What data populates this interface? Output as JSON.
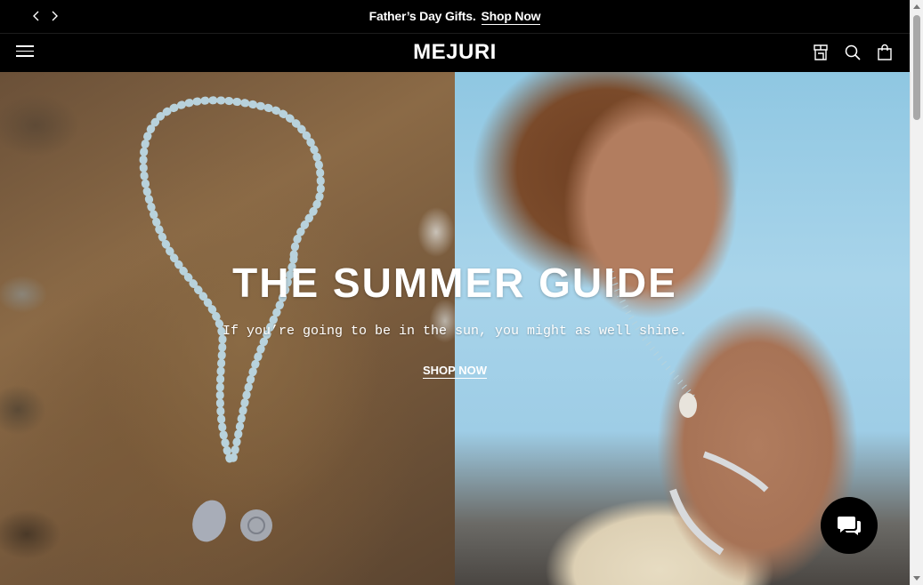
{
  "announcement": {
    "text": "Father’s Day Gifts.",
    "link_label": "Shop Now"
  },
  "header": {
    "logo": "MEJURI",
    "icons": [
      "menu-icon",
      "store-icon",
      "search-icon",
      "bag-icon"
    ]
  },
  "hero": {
    "title": "THE SUMMER GUIDE",
    "subtitle": "If you’re going to be in the sun, you might as well shine.",
    "cta_label": "SHOP NOW"
  },
  "colors": {
    "header_bg": "#000000",
    "header_text": "#ffffff",
    "chat_bg": "#000000"
  }
}
